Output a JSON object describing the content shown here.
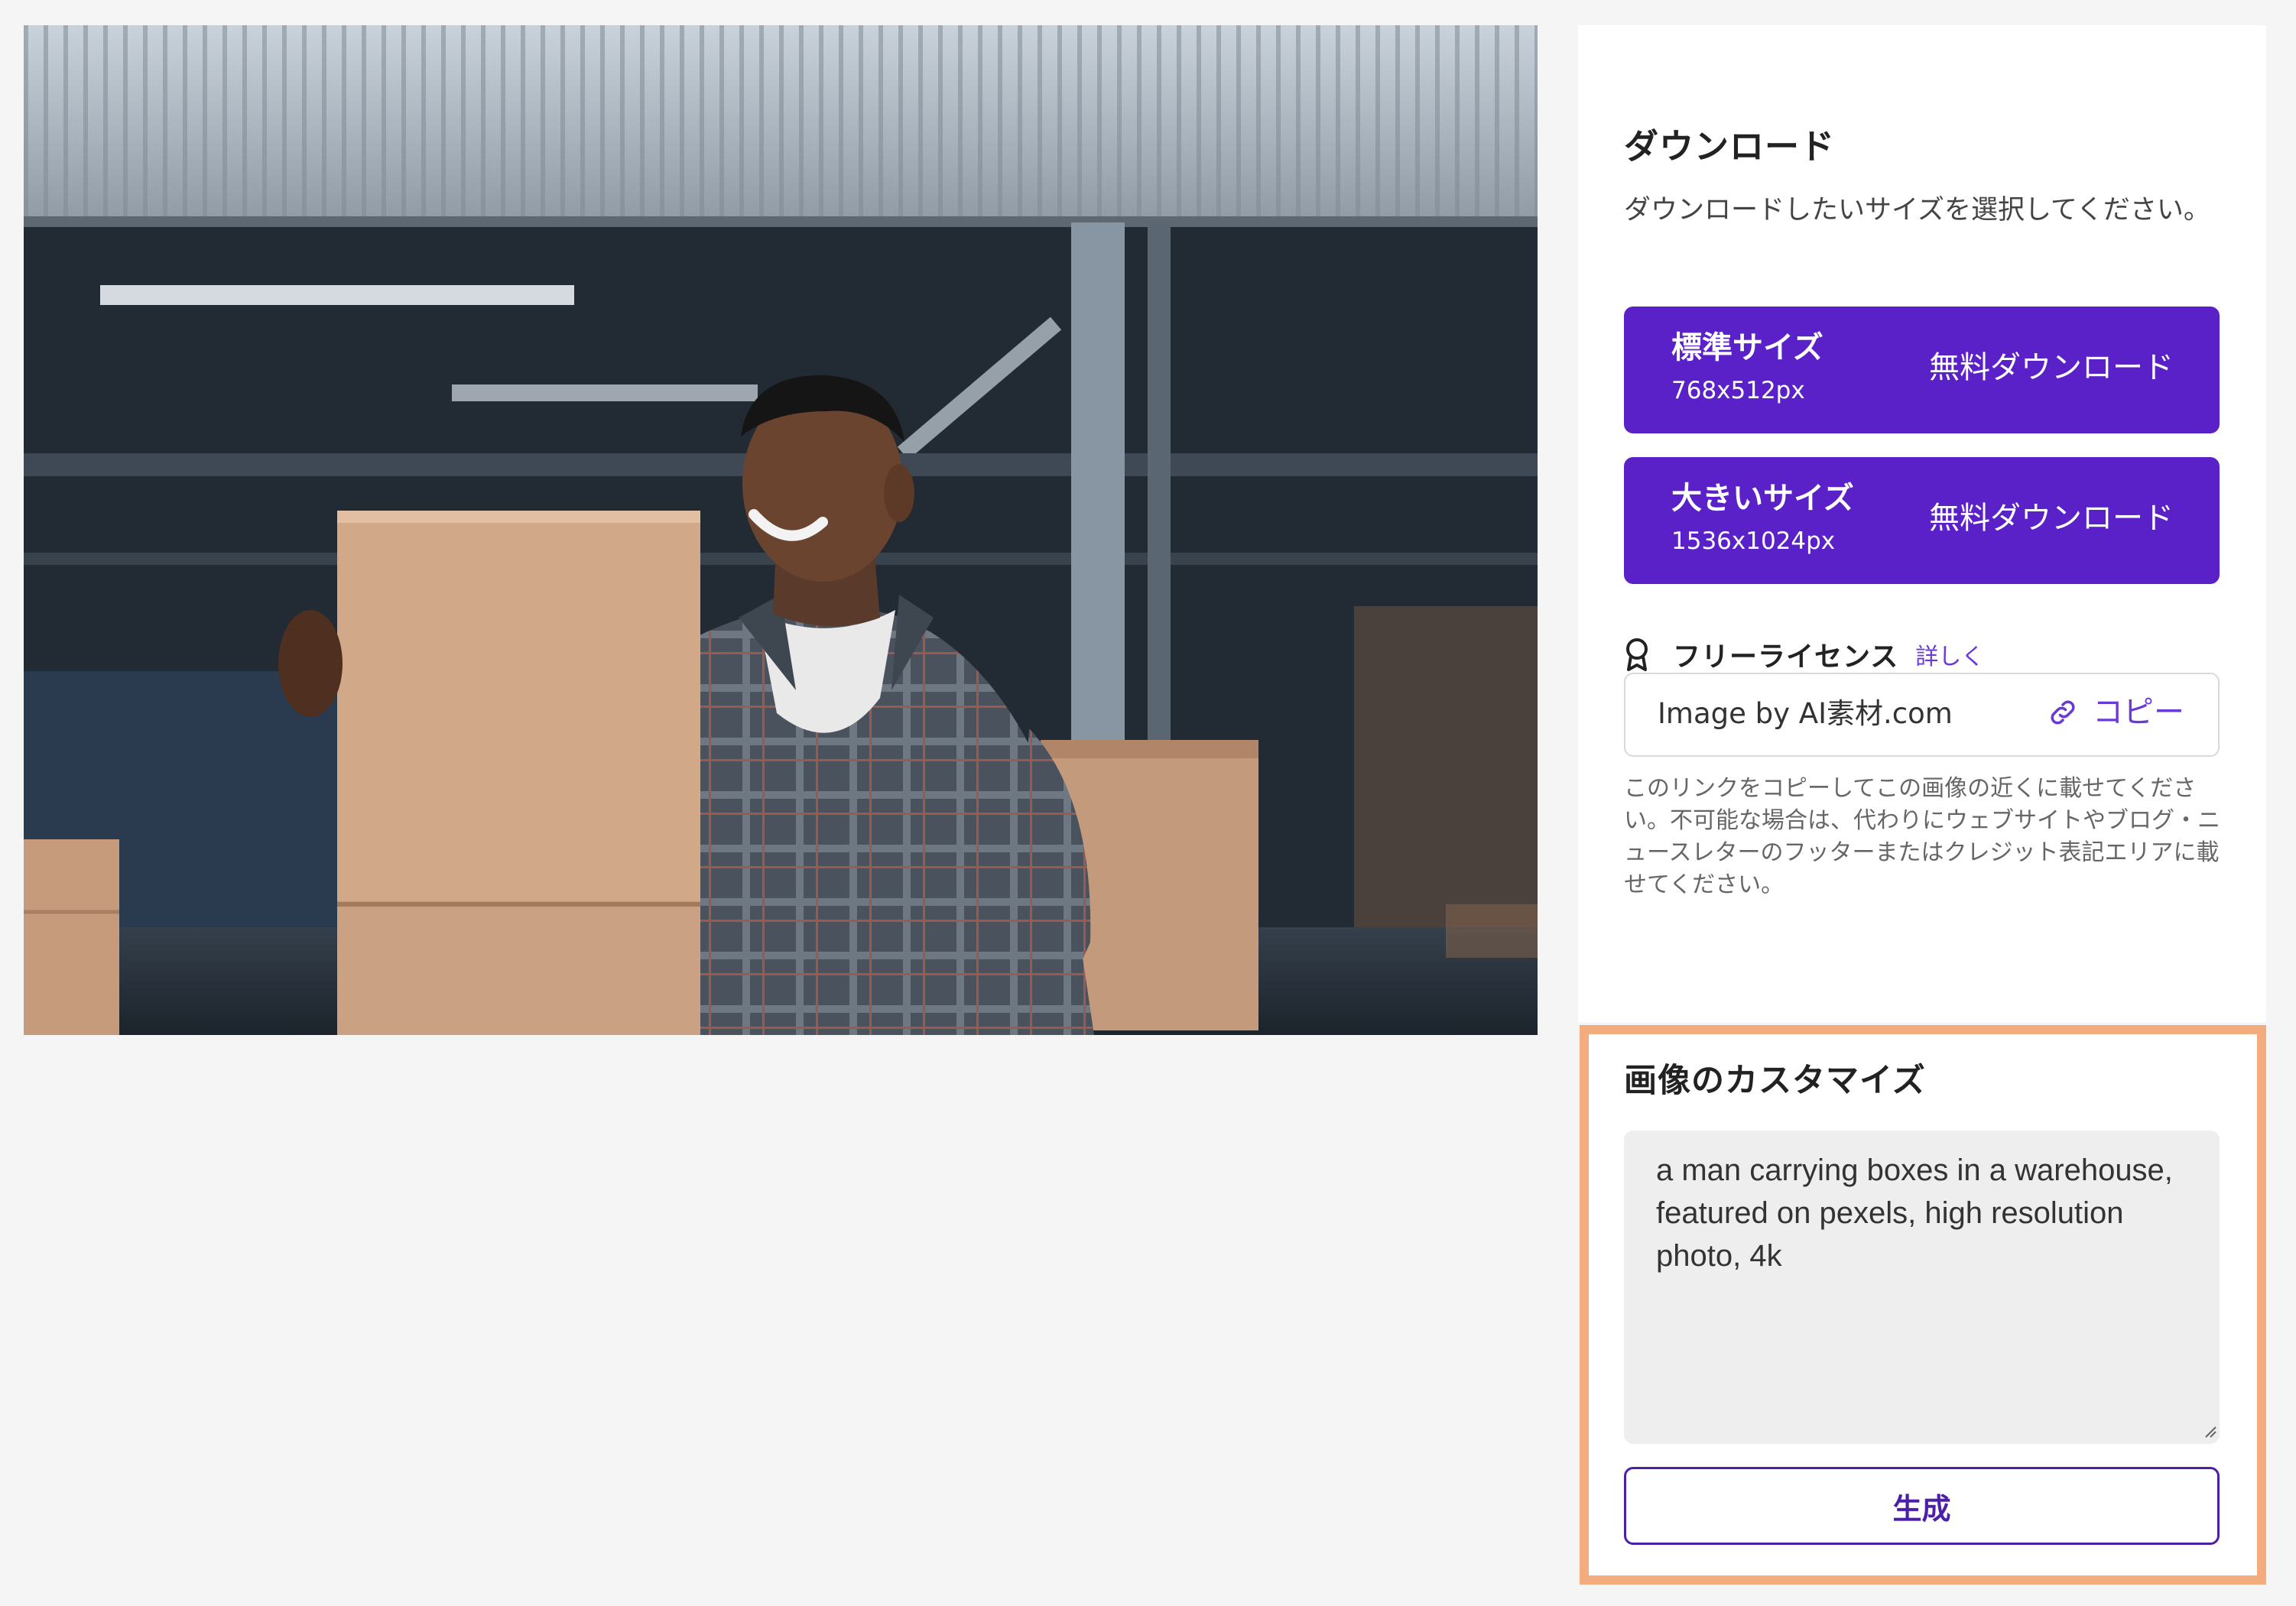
{
  "download": {
    "title": "ダウンロード",
    "description": "ダウンロードしたいサイズを選択してください。",
    "options": [
      {
        "name": "標準サイズ",
        "dimensions": "768x512px",
        "action": "無料ダウンロード"
      },
      {
        "name": "大きいサイズ",
        "dimensions": "1536x1024px",
        "action": "無料ダウンロード"
      }
    ]
  },
  "license": {
    "icon": "ribbon-icon",
    "title": "フリーライセンス",
    "more_link": "詳しく",
    "credit_text": "Image by AI素材.com",
    "copy_label": "コピー",
    "copy_icon": "link-icon",
    "notice": "このリンクをコピーしてこの画像の近くに載せてください。不可能な場合は、代わりにウェブサイトやブログ・ニュースレターのフッターまたはクレジット表記エリアに載せてください。"
  },
  "customize": {
    "title": "画像のカスタマイズ",
    "prompt_value": "a man carrying boxes in a warehouse, featured on pexels, high resolution photo, 4k",
    "generate_label": "生成"
  },
  "colors": {
    "accent": "#5b21c9",
    "link": "#6a3ad6",
    "highlight_border": "#f3ac7d",
    "page_background": "#f5f5f5"
  }
}
